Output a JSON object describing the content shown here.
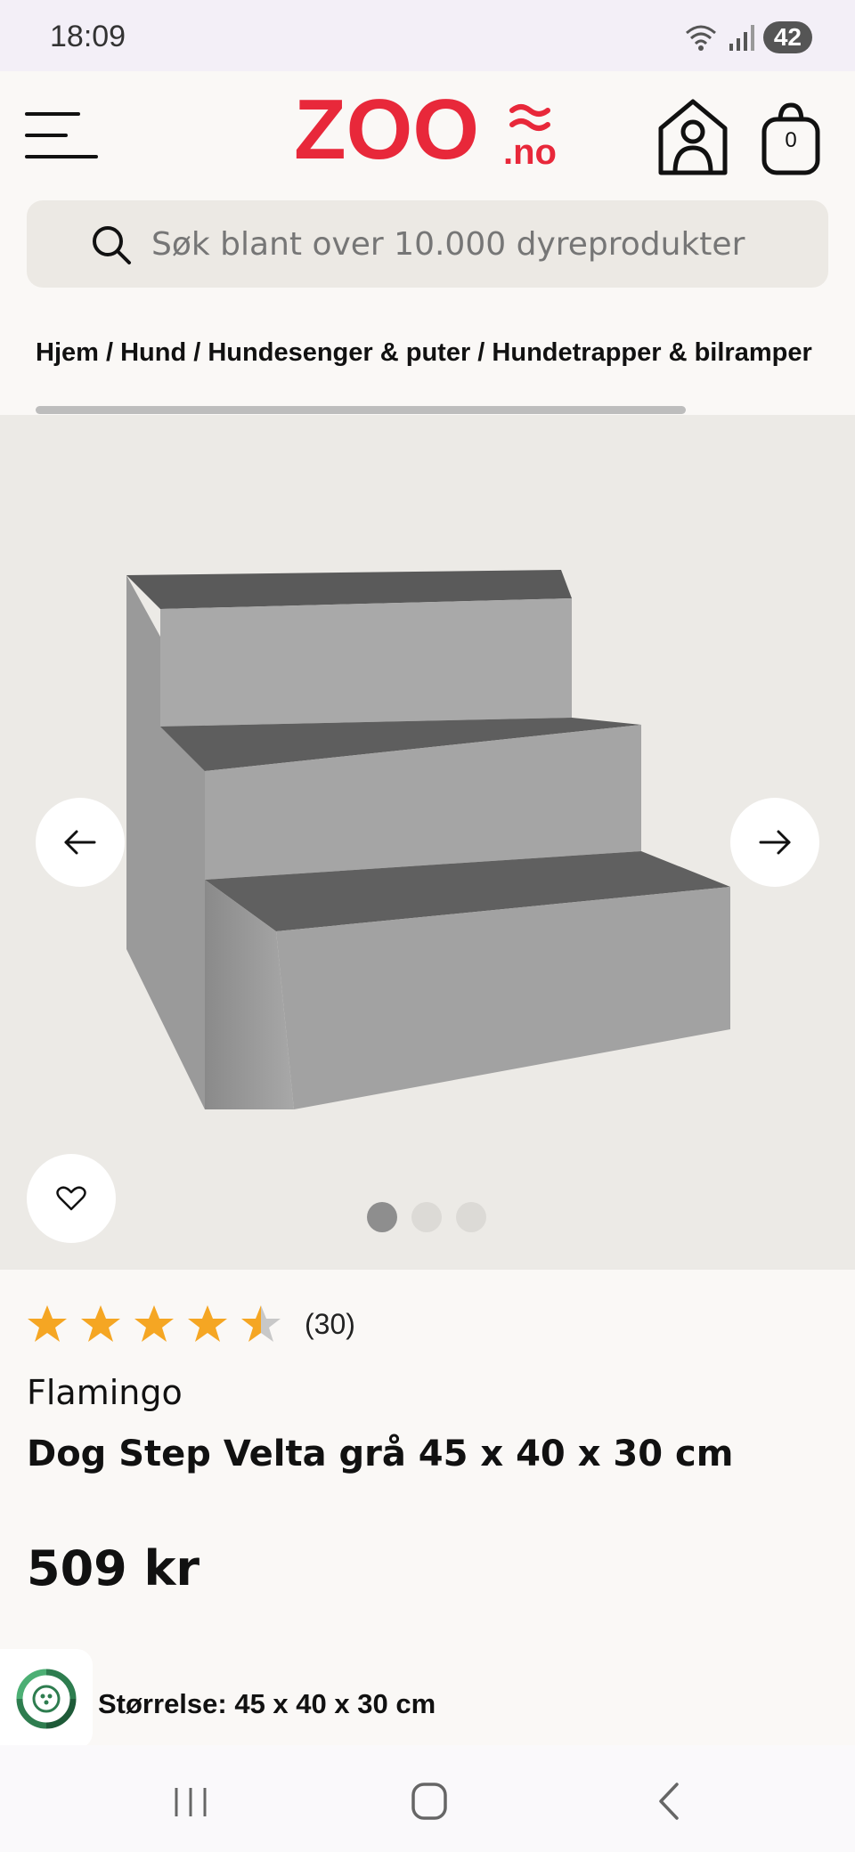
{
  "status_bar": {
    "time": "18:09",
    "battery": "42"
  },
  "header": {
    "logo": {
      "name": "ZOO",
      "suffix": ".no"
    },
    "cart_count": "0",
    "colors": {
      "brand_red": "#e8283a"
    }
  },
  "search": {
    "placeholder": "Søk blant over 10.000 dyreprodukter"
  },
  "breadcrumb": [
    "Hjem",
    "Hund",
    "Hundesenger & puter",
    "Hundetrapper & bilramper"
  ],
  "gallery": {
    "image_count": 3,
    "active_index": 0
  },
  "product": {
    "rating": 4.5,
    "review_count": "(30)",
    "brand": "Flamingo",
    "title": "Dog Step Velta grå 45 x 40 x 30 cm",
    "price": "509 kr",
    "variant": "Størrelse: 45 x 40 x 30 cm"
  },
  "icons": {
    "menu": "hamburger-menu-icon",
    "account": "doghouse-user-icon",
    "cart": "shopping-bag-icon",
    "search": "search-icon",
    "prev": "arrow-left-icon",
    "next": "arrow-right-icon",
    "favorite": "heart-icon",
    "eco": "recycle-leaf-icon"
  },
  "colors": {
    "star": "#f5a623",
    "star_empty": "#c8c8c8"
  }
}
